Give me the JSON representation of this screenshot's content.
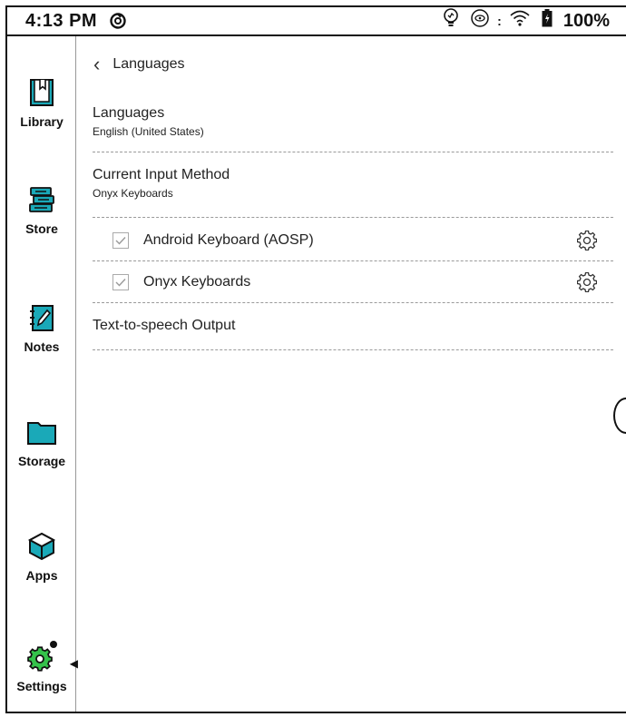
{
  "status_bar": {
    "time": "4:13 PM",
    "battery_pct": "100%",
    "icons": [
      "sync-icon",
      "lightbulb-icon",
      "eye-refresh-icon",
      "wifi-icon",
      "battery-icon"
    ]
  },
  "sidebar": {
    "items": [
      {
        "label": "Library",
        "icon": "book-icon"
      },
      {
        "label": "Store",
        "icon": "books-stack-icon"
      },
      {
        "label": "Notes",
        "icon": "notebook-pen-icon"
      },
      {
        "label": "Storage",
        "icon": "folder-icon"
      },
      {
        "label": "Apps",
        "icon": "cube-icon"
      },
      {
        "label": "Settings",
        "icon": "gear-settings-icon",
        "active": true
      }
    ]
  },
  "header": {
    "title": "Languages"
  },
  "sections": {
    "languages": {
      "title": "Languages",
      "value": "English (United States)"
    },
    "input_method": {
      "title": "Current Input Method",
      "value": "Onyx Keyboards"
    },
    "tts": {
      "title": "Text-to-speech Output"
    }
  },
  "keyboards": [
    {
      "label": "Android Keyboard (AOSP)",
      "checked": true
    },
    {
      "label": "Onyx Keyboards",
      "checked": true
    }
  ],
  "colors": {
    "accent_green": "#34c24a",
    "teal": "#1aa9b8",
    "black": "#111111"
  }
}
